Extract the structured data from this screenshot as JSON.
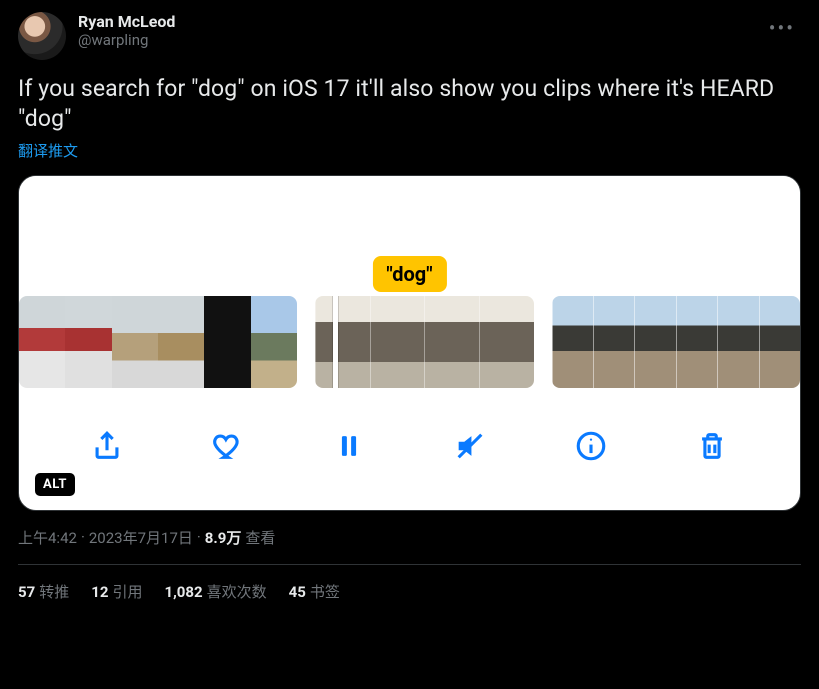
{
  "author": {
    "display_name": "Ryan McLeod",
    "handle": "@warpling"
  },
  "tweet_text": "If you search for \"dog\" on iOS 17 it'll also show you clips where it's HEARD \"dog\"",
  "translate_label": "翻译推文",
  "media": {
    "search_pill": "\"dog\"",
    "alt_badge": "ALT",
    "toolbar_icons": [
      "share",
      "like",
      "pause",
      "mute",
      "info",
      "delete"
    ]
  },
  "meta": {
    "time": "上午4:42",
    "date": "2023年7月17日",
    "views_count": "8.9万",
    "views_label": "查看"
  },
  "stats": {
    "retweets": {
      "count": "57",
      "label": "转推"
    },
    "quotes": {
      "count": "12",
      "label": "引用"
    },
    "likes": {
      "count": "1,082",
      "label": "喜欢次数"
    },
    "bookmarks": {
      "count": "45",
      "label": "书签"
    }
  }
}
